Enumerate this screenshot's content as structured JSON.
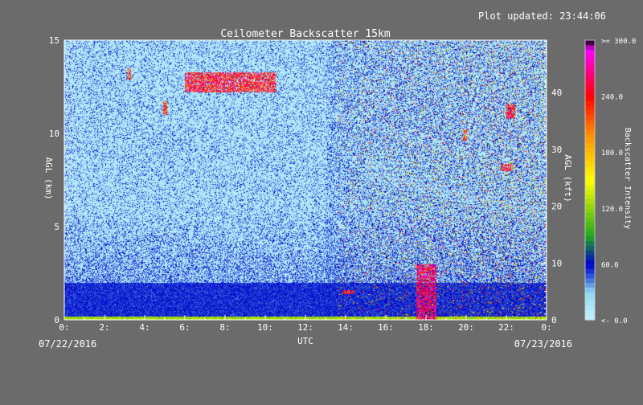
{
  "plot_updated": "Plot updated: 23:44:06",
  "colors": {
    "background": "#6b6b6b",
    "low": "#c8f0ff",
    "mid_blue": "#2040d8",
    "deep_blue": "#0000cc",
    "green": "#1fa81f",
    "yellow": "#ffff00",
    "orange": "#ff8c00",
    "red": "#ff0000",
    "magenta": "#ff00ff",
    "black": "#000000"
  },
  "chart_data": {
    "type": "heatmap",
    "title": "Ceilometer Backscatter 15km",
    "xlabel": "UTC",
    "ylabel_left": "AGL (km)",
    "ylabel_right": "AGL (kft)",
    "x_range": [
      0,
      24
    ],
    "y_range_km": [
      0,
      15
    ],
    "y_range_kft": [
      0,
      49.2
    ],
    "x_ticks": [
      "0:",
      "2:",
      "4:",
      "6:",
      "8:",
      "10:",
      "12:",
      "14:",
      "16:",
      "18:",
      "20:",
      "22:",
      "0:"
    ],
    "x_tick_values": [
      0,
      2,
      4,
      6,
      8,
      10,
      12,
      14,
      16,
      18,
      20,
      22,
      24
    ],
    "y_ticks_km": [
      "0",
      "5",
      "10",
      "15"
    ],
    "y_tick_values_km": [
      0,
      5,
      10,
      15
    ],
    "y_ticks_kft": [
      "0",
      "10",
      "20",
      "30",
      "40"
    ],
    "y_tick_values_kft": [
      0,
      10,
      20,
      30,
      40
    ],
    "start_date": "07/22/2016",
    "end_date": "07/23/2016",
    "colorbar": {
      "label": "Backscatter Intensity",
      "range": [
        0,
        300
      ],
      "ticks": [
        "<- 0.0",
        "60.0",
        "120.0",
        "180.0",
        "240.0",
        ">= 300.0"
      ],
      "tick_values": [
        0,
        60,
        120,
        180,
        240,
        300
      ]
    },
    "features": [
      {
        "kind": "surface_layer",
        "x_start": 0,
        "x_end": 24,
        "y_top_km": 0.2,
        "intensity": 110
      },
      {
        "kind": "boundary_layer",
        "x_start": 0,
        "x_end": 24,
        "y_top_km": 2.0,
        "intensity": 50
      },
      {
        "kind": "cirrus",
        "x_start": 6.0,
        "x_end": 10.5,
        "y_bottom_km": 12.2,
        "y_top_km": 13.3,
        "intensity": 280
      },
      {
        "kind": "cirrus",
        "x_start": 3.1,
        "x_end": 3.3,
        "y_bottom_km": 12.9,
        "y_top_km": 13.5,
        "intensity": 260
      },
      {
        "kind": "cirrus",
        "x_start": 4.9,
        "x_end": 5.1,
        "y_bottom_km": 11.0,
        "y_top_km": 11.8,
        "intensity": 260
      },
      {
        "kind": "precip_streak",
        "x_start": 17.5,
        "x_end": 18.5,
        "y_bottom_km": 0,
        "y_top_km": 3.0,
        "intensity": 300
      },
      {
        "kind": "cloud",
        "x_start": 13.8,
        "x_end": 14.4,
        "y_bottom_km": 1.4,
        "y_top_km": 1.6,
        "intensity": 280
      },
      {
        "kind": "cloud",
        "x_start": 22.0,
        "x_end": 22.4,
        "y_bottom_km": 10.8,
        "y_top_km": 11.6,
        "intensity": 280
      },
      {
        "kind": "cloud",
        "x_start": 21.7,
        "x_end": 22.3,
        "y_bottom_km": 8.0,
        "y_top_km": 8.4,
        "intensity": 280
      },
      {
        "kind": "cloud",
        "x_start": 19.8,
        "x_end": 20.0,
        "y_bottom_km": 9.6,
        "y_top_km": 10.3,
        "intensity": 260
      }
    ]
  }
}
